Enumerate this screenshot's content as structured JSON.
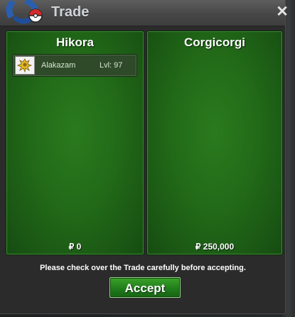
{
  "window": {
    "title": "Trade",
    "close_symbol": "✕"
  },
  "left_panel": {
    "player_name": "Hikora",
    "items": [
      {
        "icon": "alakazam-icon",
        "name": "Alakazam",
        "level": "Lvl: 97"
      }
    ],
    "money": "₽ 0"
  },
  "right_panel": {
    "player_name": "Corgicorgi",
    "items": [],
    "money": "₽ 250,000"
  },
  "footer": {
    "notice": "Please check over the Trade carefully before accepting.",
    "accept_label": "Accept"
  },
  "colors": {
    "panel_green": "#226a18",
    "accept_green": "#1f7a19",
    "titlebar_gray": "#4a4a4a"
  }
}
